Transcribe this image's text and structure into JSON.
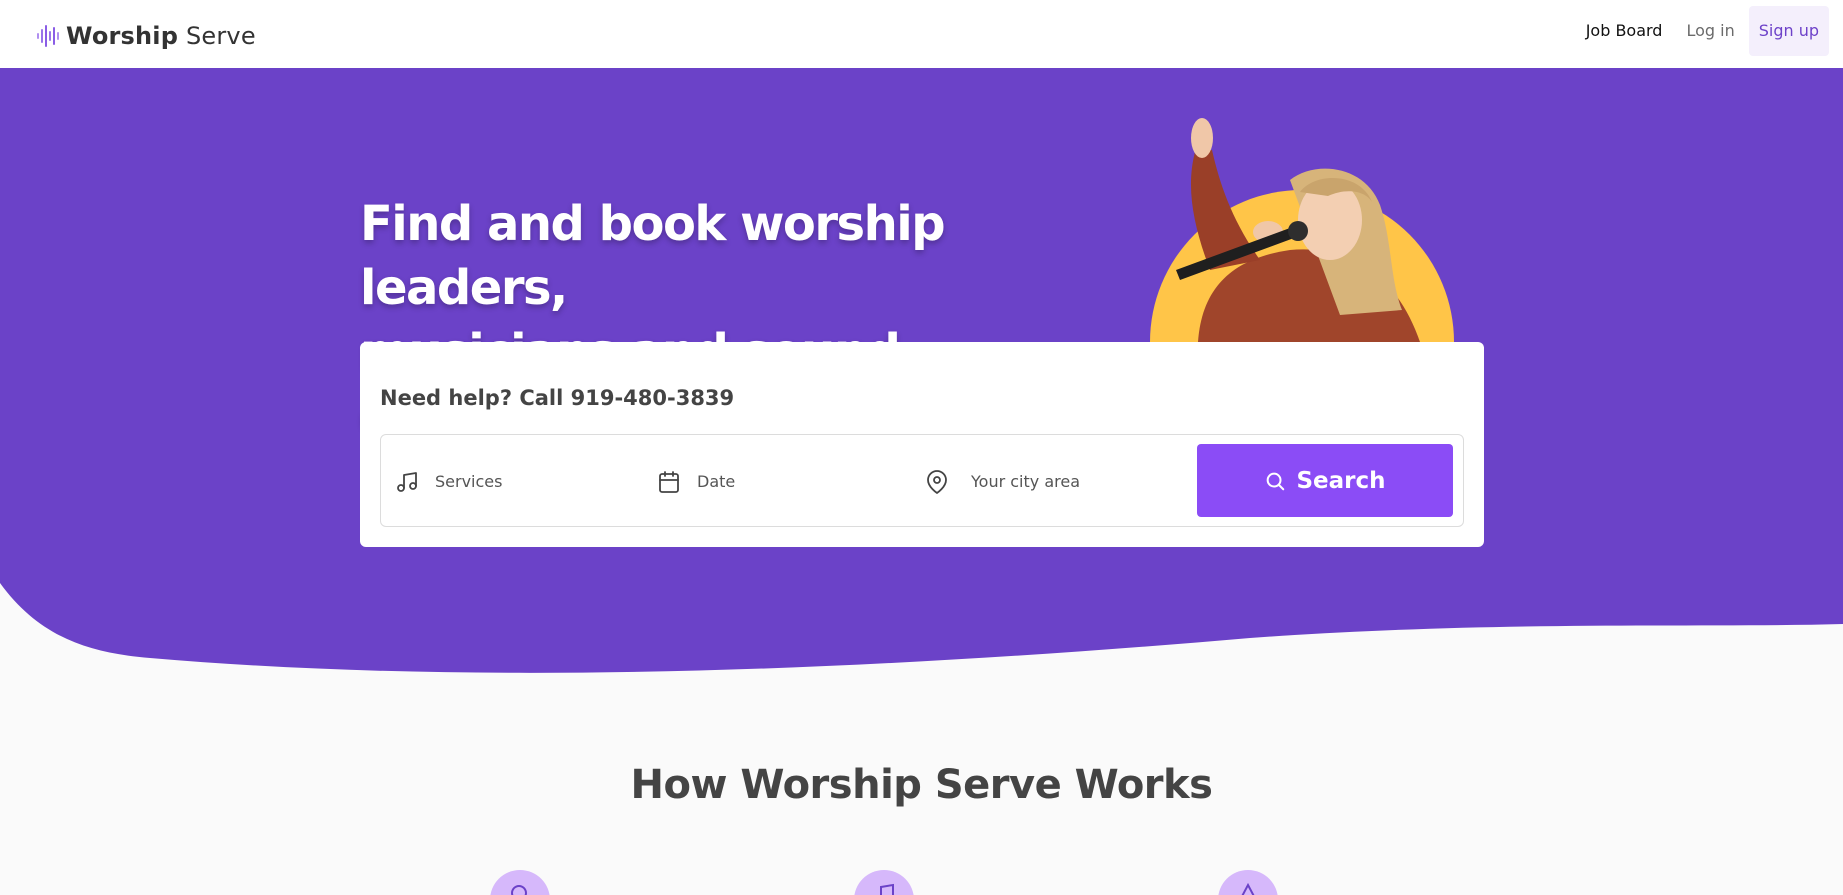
{
  "brand": {
    "name_bold": "Worship",
    "name_light": "Serve",
    "accent": "#6b42c8",
    "button": "#8b4cf6",
    "sun": "#ffc548"
  },
  "nav": {
    "job_board": "Job Board",
    "login": "Log in",
    "signup": "Sign up"
  },
  "hero": {
    "headline_line1": "Find and book worship leaders,",
    "headline_line2": "musicians and sound engineers."
  },
  "search": {
    "help_text": "Need help? Call 919-480-3839",
    "services_placeholder": "Services",
    "date_placeholder": "Date",
    "city_placeholder": "Your city area",
    "button_label": "Search"
  },
  "how_it_works": {
    "title": "How Worship Serve Works"
  }
}
